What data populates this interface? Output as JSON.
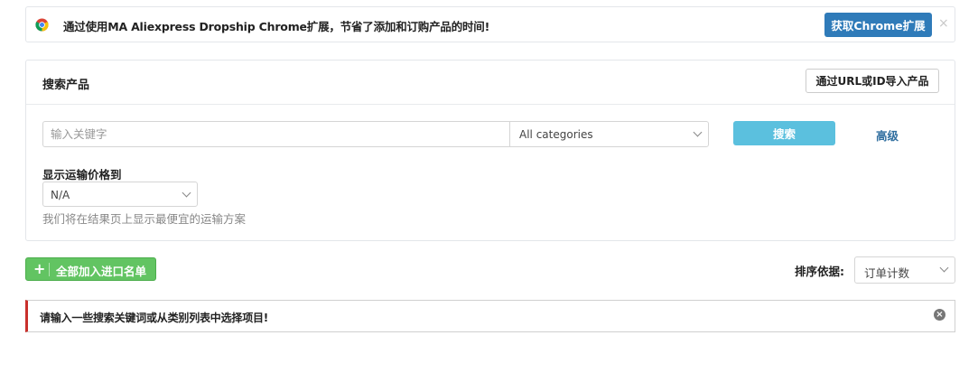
{
  "notice": {
    "icon": "chrome-icon",
    "text": "通过使用MA Aliexpress Dropship Chrome扩展，节省了添加和订购产品的时间!",
    "button_label": "获取Chrome扩展",
    "close_glyph": "×"
  },
  "search_panel": {
    "title": "搜索产品",
    "import_button_label": "通过URL或ID导入产品",
    "keyword_placeholder": "输入关键字",
    "category_value": "All categories",
    "search_button_label": "搜索",
    "advanced_link_label": "高级",
    "shipping_label": "显示运输价格到",
    "shipping_value": "N/A",
    "shipping_help": "我们将在结果页上显示最便宜的运输方案"
  },
  "toolbar": {
    "add_all_label": "全部加入进口名单",
    "add_all_icon": "plus-icon",
    "sort_label": "排序依据:",
    "sort_value": "订单计数"
  },
  "alert": {
    "text": "请输入一些搜索关键词或从类别列表中选择项目!",
    "close_icon": "close-circle-icon"
  },
  "colors": {
    "primary": "#2f7bb9",
    "info": "#5bc0de",
    "success": "#62c462",
    "danger": "#c9302c",
    "link": "#2f6e9f"
  }
}
